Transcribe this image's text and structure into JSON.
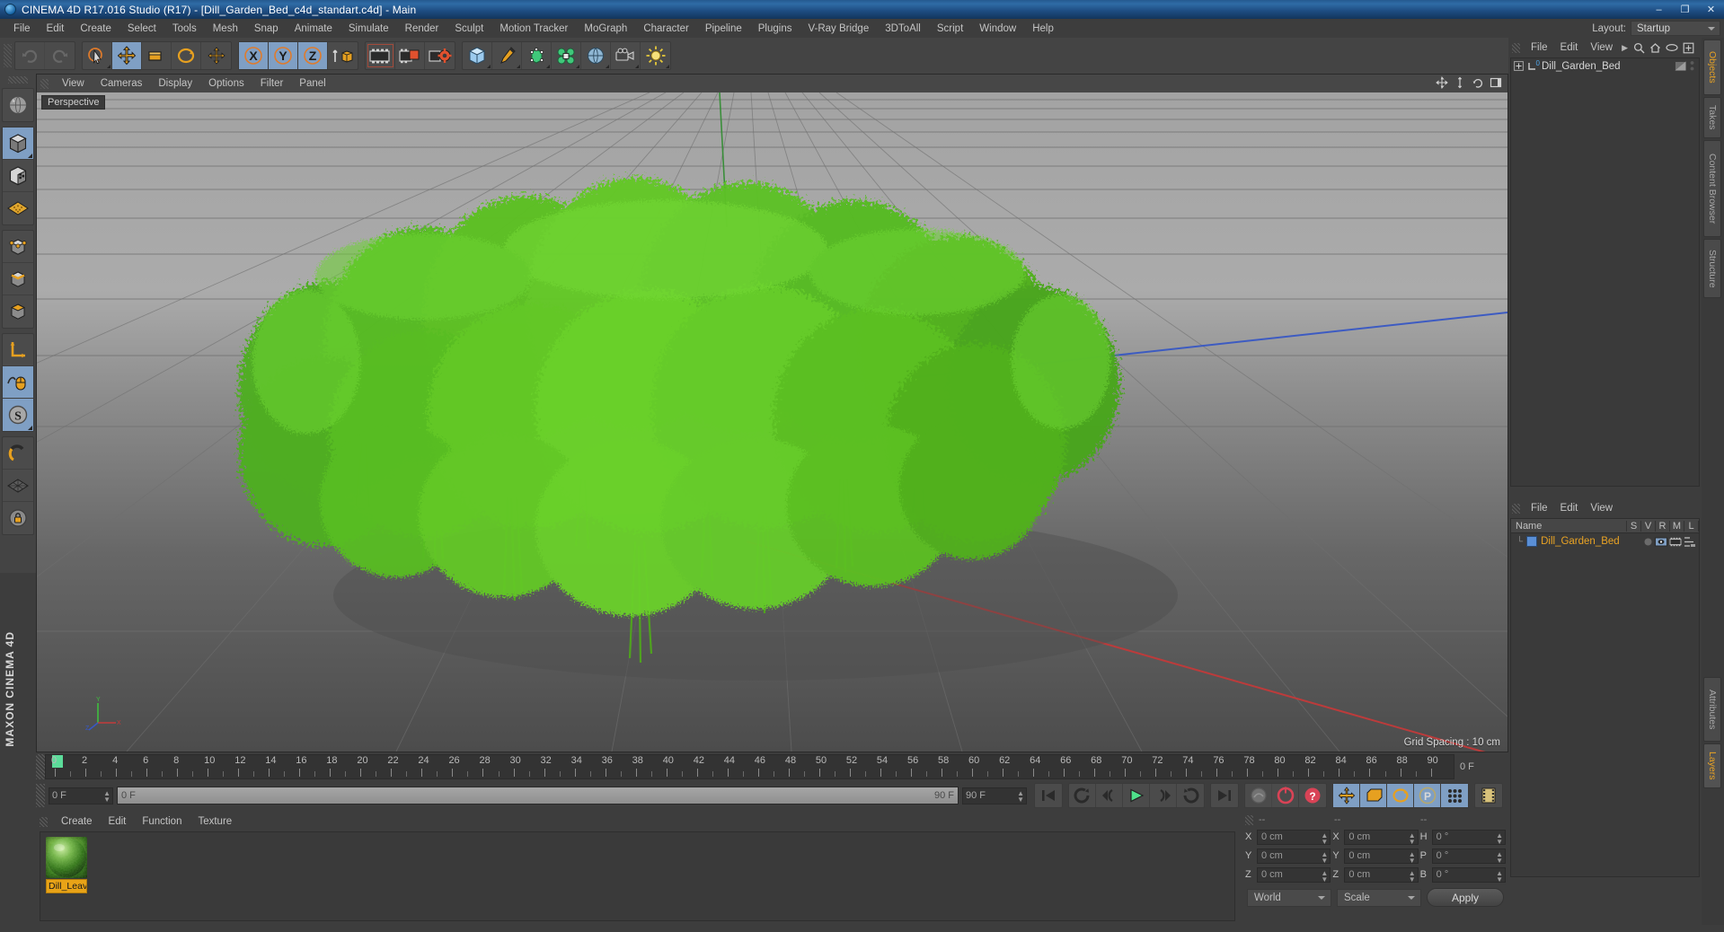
{
  "window": {
    "title": "CINEMA 4D R17.016 Studio (R17) - [Dill_Garden_Bed_c4d_standart.c4d] - Main",
    "app_icon": "cinema4d-logo-icon",
    "minimize": "–",
    "maximize": "❐",
    "close": "✕"
  },
  "menu": {
    "items": [
      {
        "label": "File"
      },
      {
        "label": "Edit"
      },
      {
        "label": "Create"
      },
      {
        "label": "Select"
      },
      {
        "label": "Tools"
      },
      {
        "label": "Mesh"
      },
      {
        "label": "Snap"
      },
      {
        "label": "Animate"
      },
      {
        "label": "Simulate"
      },
      {
        "label": "Render"
      },
      {
        "label": "Sculpt"
      },
      {
        "label": "Motion Tracker"
      },
      {
        "label": "MoGraph"
      },
      {
        "label": "Character"
      },
      {
        "label": "Pipeline"
      },
      {
        "label": "Plugins"
      },
      {
        "label": "V-Ray Bridge"
      },
      {
        "label": "3DToAll"
      },
      {
        "label": "Script"
      },
      {
        "label": "Window"
      },
      {
        "label": "Help"
      }
    ],
    "layout_label": "Layout:",
    "layout_value": "Startup"
  },
  "toolbar": {
    "groups": [
      {
        "name": "undo-redo",
        "buttons": [
          {
            "icon": "undo-icon",
            "active": false,
            "dim": true
          },
          {
            "icon": "redo-icon",
            "active": false,
            "dim": true
          }
        ]
      },
      {
        "name": "transform-tools",
        "buttons": [
          {
            "icon": "live-selection-icon",
            "active": false
          },
          {
            "icon": "move-icon",
            "active": true
          },
          {
            "icon": "scale-icon",
            "active": false
          },
          {
            "icon": "rotate-icon",
            "active": false
          },
          {
            "icon": "move-alt-icon",
            "active": false
          }
        ]
      },
      {
        "name": "axis-locks",
        "buttons": [
          {
            "icon": "x-axis-icon",
            "active": true
          },
          {
            "icon": "y-axis-icon",
            "active": true
          },
          {
            "icon": "z-axis-icon",
            "active": true
          },
          {
            "icon": "world-object-axis-icon",
            "active": false
          }
        ]
      },
      {
        "name": "render-tools",
        "buttons": [
          {
            "icon": "render-view-icon",
            "active": false
          },
          {
            "icon": "render-region-icon",
            "active": false
          },
          {
            "icon": "render-settings-icon",
            "active": false
          }
        ]
      },
      {
        "name": "create-objects",
        "buttons": [
          {
            "icon": "cube-primitive-icon",
            "active": false
          },
          {
            "icon": "spline-pen-icon",
            "active": false
          },
          {
            "icon": "nurbs-generator-icon",
            "active": false
          },
          {
            "icon": "array-deformer-icon",
            "active": false
          },
          {
            "icon": "scene-environment-icon",
            "active": false
          },
          {
            "icon": "camera-icon",
            "active": false
          },
          {
            "icon": "light-icon",
            "active": false
          }
        ]
      }
    ]
  },
  "left_toolbar": {
    "groups": [
      {
        "buttons": [
          {
            "icon": "undo-view-icon",
            "active": false
          }
        ]
      },
      {
        "buttons": [
          {
            "icon": "make-editable-icon",
            "active": true
          },
          {
            "icon": "viewport-solo-icon",
            "active": false
          },
          {
            "icon": "texture-axis-icon",
            "active": false
          }
        ]
      },
      {
        "buttons": [
          {
            "icon": "point-mode-icon",
            "active": false
          },
          {
            "icon": "edge-mode-icon",
            "active": false
          },
          {
            "icon": "polygon-mode-icon",
            "active": false
          }
        ]
      },
      {
        "buttons": [
          {
            "icon": "object-axis-icon",
            "active": false
          },
          {
            "icon": "enable-axis-icon",
            "active": true
          },
          {
            "icon": "soft-selection-icon",
            "active": true
          }
        ]
      },
      {
        "buttons": [
          {
            "icon": "magnet-icon",
            "active": false
          },
          {
            "icon": "workplane-icon",
            "active": false
          },
          {
            "icon": "lock-workplane-icon",
            "active": false
          }
        ]
      }
    ],
    "brand": "MAXON CINEMA 4D"
  },
  "viewport": {
    "menu": [
      {
        "label": "View"
      },
      {
        "label": "Cameras"
      },
      {
        "label": "Display"
      },
      {
        "label": "Options"
      },
      {
        "label": "Filter"
      },
      {
        "label": "Panel"
      }
    ],
    "label": "Perspective",
    "grid_spacing": "Grid Spacing : 10 cm",
    "corner_icons": [
      "pan-view-icon",
      "zoom-view-icon",
      "rotate-view-icon",
      "maximize-view-icon"
    ],
    "scene_description": "Dill garden bed — dense cluster of green dill plants on ground plane",
    "axis_colors": {
      "x": "#cc3333",
      "y": "#3dbb3d",
      "z": "#3366cc"
    }
  },
  "timeline": {
    "current_frame_marker": 0,
    "ticks": [
      0,
      2,
      4,
      6,
      8,
      10,
      12,
      14,
      16,
      18,
      20,
      22,
      24,
      26,
      28,
      30,
      32,
      34,
      36,
      38,
      40,
      42,
      44,
      46,
      48,
      50,
      52,
      54,
      56,
      58,
      60,
      62,
      64,
      66,
      68,
      70,
      72,
      74,
      76,
      78,
      80,
      82,
      84,
      86,
      88,
      90
    ],
    "end_label": "0 F"
  },
  "transport": {
    "current_frame": "0 F",
    "scrub_left": "0 F",
    "scrub_right": "90 F",
    "preview_end": "90 F",
    "buttons_nav": [
      {
        "icon": "go-to-start-icon"
      }
    ],
    "buttons_play": [
      {
        "icon": "play-reverse-icon"
      },
      {
        "icon": "step-back-icon"
      },
      {
        "icon": "play-forward-icon",
        "accent": "#4fe08a"
      },
      {
        "icon": "step-forward-icon"
      },
      {
        "icon": "loop-icon"
      }
    ],
    "buttons_end": [
      {
        "icon": "go-to-end-icon"
      }
    ],
    "buttons_record": [
      {
        "icon": "autokey-icon",
        "dim": true
      },
      {
        "icon": "record-keyframe-icon",
        "accent": "#d94356"
      },
      {
        "icon": "keyframe-selection-icon",
        "accent": "#d94356"
      }
    ],
    "buttons_keys": [
      {
        "icon": "key-position-icon",
        "active": true
      },
      {
        "icon": "key-scale-icon",
        "active": true
      },
      {
        "icon": "key-rotation-icon",
        "active": true
      },
      {
        "icon": "key-param-icon",
        "active": true
      },
      {
        "icon": "key-pla-icon",
        "active": true
      }
    ],
    "buttons_anim": [
      {
        "icon": "timeline-filmstrip-icon"
      }
    ]
  },
  "material_manager": {
    "menu": [
      {
        "label": "Create"
      },
      {
        "label": "Edit"
      },
      {
        "label": "Function"
      },
      {
        "label": "Texture"
      }
    ],
    "materials": [
      {
        "name": "Dill_Leav",
        "preview": "green-leaves-sphere-icon",
        "selected": true
      }
    ]
  },
  "coordinates": {
    "header_cols": [
      "--",
      "--",
      "--"
    ],
    "rows": [
      {
        "label1": "X",
        "value1": "0 cm",
        "label2": "X",
        "value2": "0 cm",
        "label3": "H",
        "value3": "0 °"
      },
      {
        "label1": "Y",
        "value1": "0 cm",
        "label2": "Y",
        "value2": "0 cm",
        "label3": "P",
        "value3": "0 °"
      },
      {
        "label1": "Z",
        "value1": "0 cm",
        "label2": "Z",
        "value2": "0 cm",
        "label3": "B",
        "value3": "0 °"
      }
    ],
    "system": "World",
    "mode": "Scale",
    "apply": "Apply"
  },
  "object_manager": {
    "menu": [
      {
        "label": "File"
      },
      {
        "label": "Edit"
      },
      {
        "label": "View"
      }
    ],
    "more_icon": "chevron-right-icon",
    "header_icons": [
      "search-icon",
      "home-icon",
      "eye-icon",
      "fit-icon"
    ],
    "objects": [
      {
        "name": "Dill_Garden_Bed",
        "level_badge": "0",
        "expandable": true,
        "selected": false
      }
    ]
  },
  "layer_manager": {
    "menu": [
      {
        "label": "File"
      },
      {
        "label": "Edit"
      },
      {
        "label": "View"
      }
    ],
    "columns": [
      "Name",
      "S",
      "V",
      "R",
      "M",
      "L"
    ],
    "rows": [
      {
        "name": "Dill_Garden_Bed",
        "color": "#5a8fd6"
      }
    ]
  },
  "right_tabs": {
    "top": [
      {
        "label": "Objects",
        "selected": true
      },
      {
        "label": "Takes",
        "selected": false
      },
      {
        "label": "Content Browser",
        "selected": false
      },
      {
        "label": "Structure",
        "selected": false
      }
    ],
    "bottom": [
      {
        "label": "Attributes",
        "selected": false
      },
      {
        "label": "Layers",
        "selected": true
      }
    ]
  },
  "colors": {
    "accent_orange": "#e9a324",
    "panel_bg": "#3d3d3d",
    "panel_dark": "#3a3a3a",
    "toolbar_bg": "#444444",
    "active_blue": "#7f9fc4",
    "title_blue": "#2f6ca6"
  }
}
